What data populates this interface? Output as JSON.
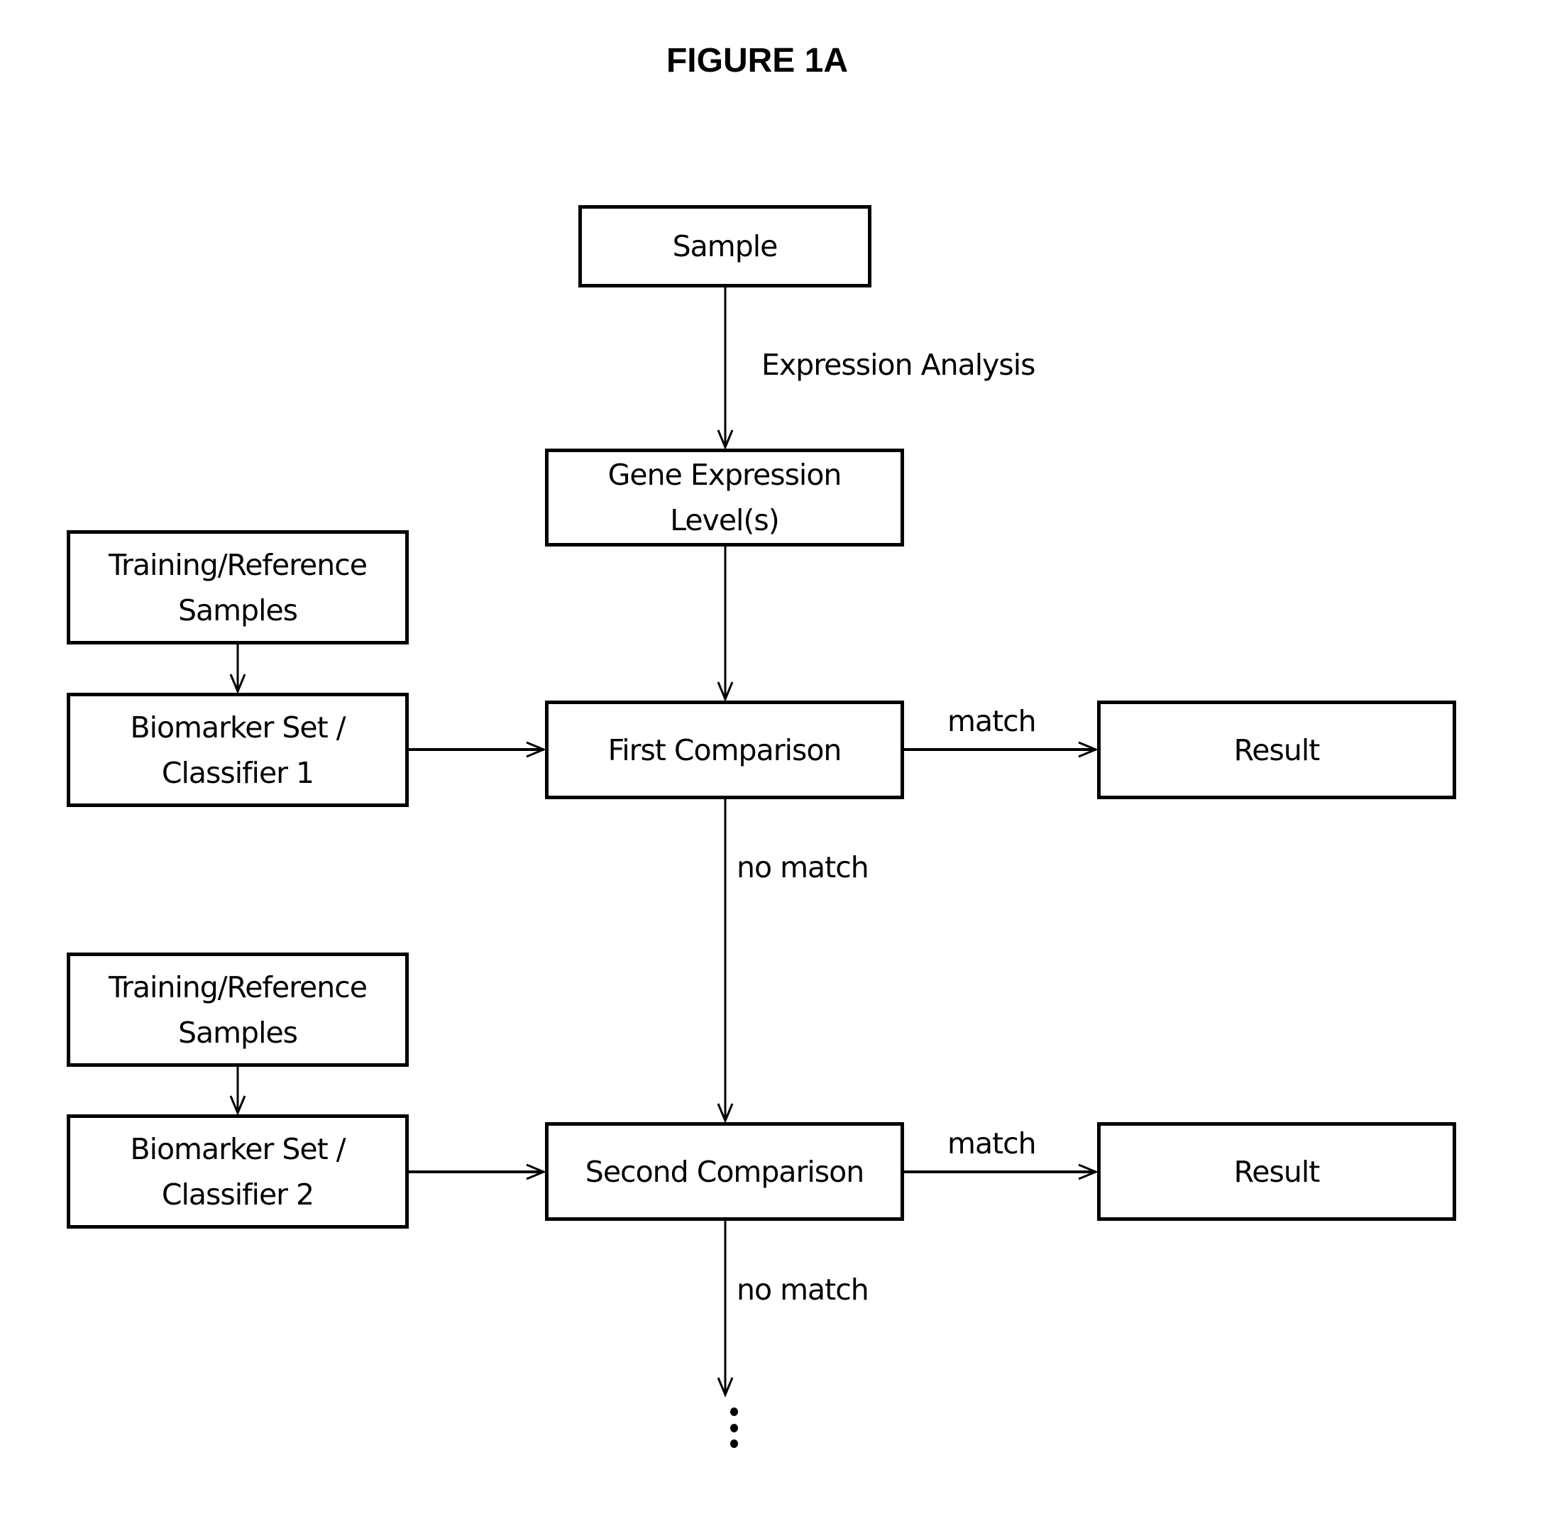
{
  "title": "FIGURE 1A",
  "nodes": {
    "sample": "Sample",
    "gene_expression": [
      "Gene Expression",
      "Level(s)"
    ],
    "training_1": [
      "Training/Reference",
      "Samples"
    ],
    "biomarker_1": [
      "Biomarker Set /",
      "Classifier 1"
    ],
    "first_comparison": "First Comparison",
    "result_1": "Result",
    "training_2": [
      "Training/Reference",
      "Samples"
    ],
    "biomarker_2": [
      "Biomarker Set /",
      "Classifier 2"
    ],
    "second_comparison": "Second Comparison",
    "result_2": "Result"
  },
  "edge_labels": {
    "expression_analysis": "Expression Analysis",
    "match_1": "match",
    "no_match_1": "no match",
    "match_2": "match",
    "no_match_2": "no match"
  },
  "continuation": "ellipsis-vertical"
}
